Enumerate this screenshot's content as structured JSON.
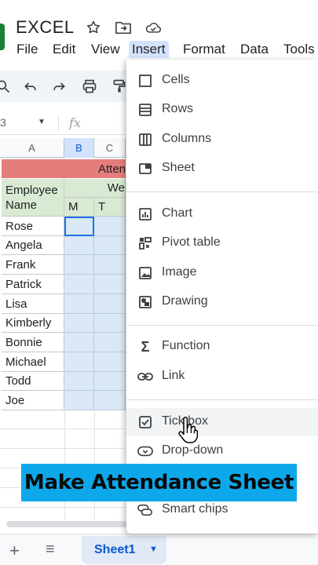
{
  "app": {
    "title": "EXCEL",
    "title_icons": [
      "star-icon",
      "move-to-folder-icon",
      "cloud-status-icon"
    ]
  },
  "menu": {
    "items": [
      "File",
      "Edit",
      "View",
      "Insert",
      "Format",
      "Data",
      "Tools"
    ],
    "active": "Insert"
  },
  "toolbar": {
    "icons": [
      "search-icon",
      "undo-icon",
      "redo-icon",
      "print-icon",
      "paint-format-icon"
    ]
  },
  "formula_bar": {
    "cell_ref": "3",
    "fx": "fx"
  },
  "grid": {
    "columns": [
      "A",
      "B",
      "C"
    ],
    "selected_column": "B",
    "banner_text": "Atten",
    "header_week": "We",
    "header_employee": "Employee Name",
    "day_headers": [
      "M",
      "T"
    ],
    "employees": [
      "Rose",
      "Angela",
      "Frank",
      "Patrick",
      "Lisa",
      "Kimberly",
      "Bonnie",
      "Michael",
      "Todd",
      "Joe"
    ]
  },
  "insert_menu": {
    "groups": [
      [
        {
          "label": "Cells",
          "icon": "cells-icon"
        },
        {
          "label": "Rows",
          "icon": "rows-icon"
        },
        {
          "label": "Columns",
          "icon": "columns-icon"
        },
        {
          "label": "Sheet",
          "icon": "sheet-icon"
        }
      ],
      [
        {
          "label": "Chart",
          "icon": "chart-icon"
        },
        {
          "label": "Pivot table",
          "icon": "pivot-table-icon"
        },
        {
          "label": "Image",
          "icon": "image-icon"
        },
        {
          "label": "Drawing",
          "icon": "drawing-icon"
        }
      ],
      [
        {
          "label": "Function",
          "icon": "function-sigma-icon"
        },
        {
          "label": "Link",
          "icon": "link-icon"
        }
      ],
      [
        {
          "label": "Tick box",
          "icon": "tick-box-icon"
        },
        {
          "label": "Drop-down",
          "icon": "dropdown-chip-icon"
        },
        {
          "label": "Smart chips",
          "icon": "smart-chips-icon"
        }
      ]
    ],
    "hovered": "Tick box"
  },
  "bottom": {
    "add_label": "+",
    "all_sheets_label": "≡",
    "sheet_tab": "Sheet1",
    "sheet_tab_arrow": "▼"
  },
  "caption": {
    "text": "Make Attendance Sheet"
  },
  "colors": {
    "sheets_green": "#188038",
    "banner_red": "#e06666",
    "header_green": "#d9ead3",
    "cell_blue": "#dbe8f5",
    "caption_bg": "#0da8ea",
    "selection_blue": "#1a73e8"
  }
}
